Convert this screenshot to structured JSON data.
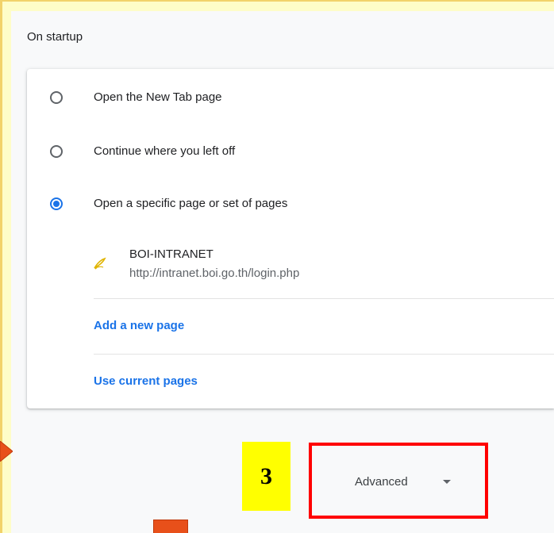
{
  "section": {
    "title": "On startup"
  },
  "startup_options": [
    {
      "label": "Open the New Tab page",
      "selected": false
    },
    {
      "label": "Continue where you left off",
      "selected": false
    },
    {
      "label": "Open a specific page or set of pages",
      "selected": true
    }
  ],
  "pages": [
    {
      "name": "BOI-INTRANET",
      "url": "http://intranet.boi.go.th/login.php",
      "icon": "yellow-feather-favicon-icon"
    }
  ],
  "actions": {
    "add_new_page": "Add a new page",
    "use_current_pages": "Use current pages"
  },
  "advanced": {
    "label": "Advanced",
    "icon": "caret-down-icon"
  },
  "annotation": {
    "step_number": "3"
  },
  "colors": {
    "background": "#fefdc8",
    "accent": "#1a73e8",
    "highlight_box": "#ff0000",
    "step_marker": "#ffff00",
    "arrow": "#e8501a"
  }
}
